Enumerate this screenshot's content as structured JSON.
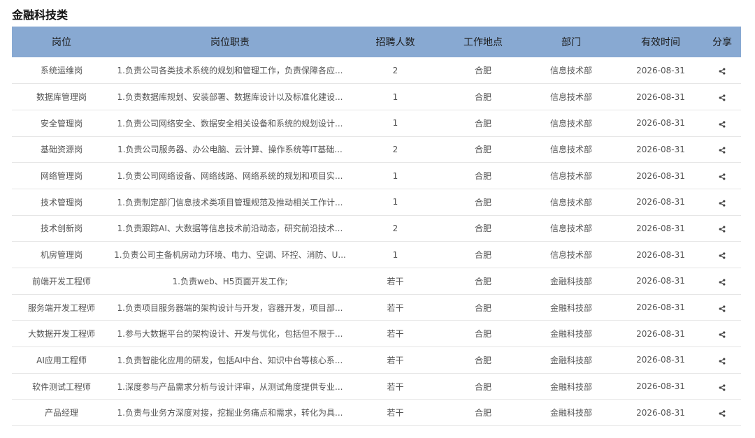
{
  "section": {
    "title": "金融科技类"
  },
  "table": {
    "headers": [
      "岗位",
      "岗位职责",
      "招聘人数",
      "工作地点",
      "部门",
      "有效时间",
      "分享"
    ],
    "rows": [
      {
        "position": "系统运维岗",
        "duty": "1.负责公司各类技术系统的规划和管理工作，负责保障各应...",
        "count": "2",
        "location": "合肥",
        "department": "信息技术部",
        "date": "2026-08-31"
      },
      {
        "position": "数据库管理岗",
        "duty": "1.负责数据库规划、安装部署、数据库设计以及标准化建设...",
        "count": "1",
        "location": "合肥",
        "department": "信息技术部",
        "date": "2026-08-31"
      },
      {
        "position": "安全管理岗",
        "duty": "1.负责公司网络安全、数据安全相关设备和系统的规划设计...",
        "count": "1",
        "location": "合肥",
        "department": "信息技术部",
        "date": "2026-08-31"
      },
      {
        "position": "基础资源岗",
        "duty": "1.负责公司服务器、办公电脑、云计算、操作系统等IT基础...",
        "count": "2",
        "location": "合肥",
        "department": "信息技术部",
        "date": "2026-08-31"
      },
      {
        "position": "网络管理岗",
        "duty": "1.负责公司网络设备、网络线路、网络系统的规划和项目实...",
        "count": "1",
        "location": "合肥",
        "department": "信息技术部",
        "date": "2026-08-31"
      },
      {
        "position": "技术管理岗",
        "duty": "1.负责制定部门信息技术类项目管理规范及推动相关工作计...",
        "count": "1",
        "location": "合肥",
        "department": "信息技术部",
        "date": "2026-08-31"
      },
      {
        "position": "技术创新岗",
        "duty": "1.负责跟踪AI、大数据等信息技术前沿动态，研究前沿技术...",
        "count": "2",
        "location": "合肥",
        "department": "信息技术部",
        "date": "2026-08-31"
      },
      {
        "position": "机房管理岗",
        "duty": "1.负责公司主备机房动力环境、电力、空调、环控、消防、U...",
        "count": "1",
        "location": "合肥",
        "department": "信息技术部",
        "date": "2026-08-31"
      },
      {
        "position": "前端开发工程师",
        "duty": "1.负责web、H5页面开发工作;",
        "count": "若干",
        "location": "合肥",
        "department": "金融科技部",
        "date": "2026-08-31"
      },
      {
        "position": "服务端开发工程师",
        "duty": "1.负责项目服务器端的架构设计与开发，容器开发，项目部...",
        "count": "若干",
        "location": "合肥",
        "department": "金融科技部",
        "date": "2026-08-31"
      },
      {
        "position": "大数据开发工程师",
        "duty": "1.参与大数据平台的架构设计、开发与优化，包括但不限于...",
        "count": "若干",
        "location": "合肥",
        "department": "金融科技部",
        "date": "2026-08-31"
      },
      {
        "position": "AI应用工程师",
        "duty": "1.负责智能化应用的研发，包括AI中台、知识中台等核心系...",
        "count": "若干",
        "location": "合肥",
        "department": "金融科技部",
        "date": "2026-08-31"
      },
      {
        "position": "软件测试工程师",
        "duty": "1.深度参与产品需求分析与设计评审，从测试角度提供专业...",
        "count": "若干",
        "location": "合肥",
        "department": "金融科技部",
        "date": "2026-08-31"
      },
      {
        "position": "产品经理",
        "duty": "1.负责与业务方深度对接，挖掘业务痛点和需求，转化为具...",
        "count": "若干",
        "location": "合肥",
        "department": "金融科技部",
        "date": "2026-08-31"
      }
    ]
  }
}
